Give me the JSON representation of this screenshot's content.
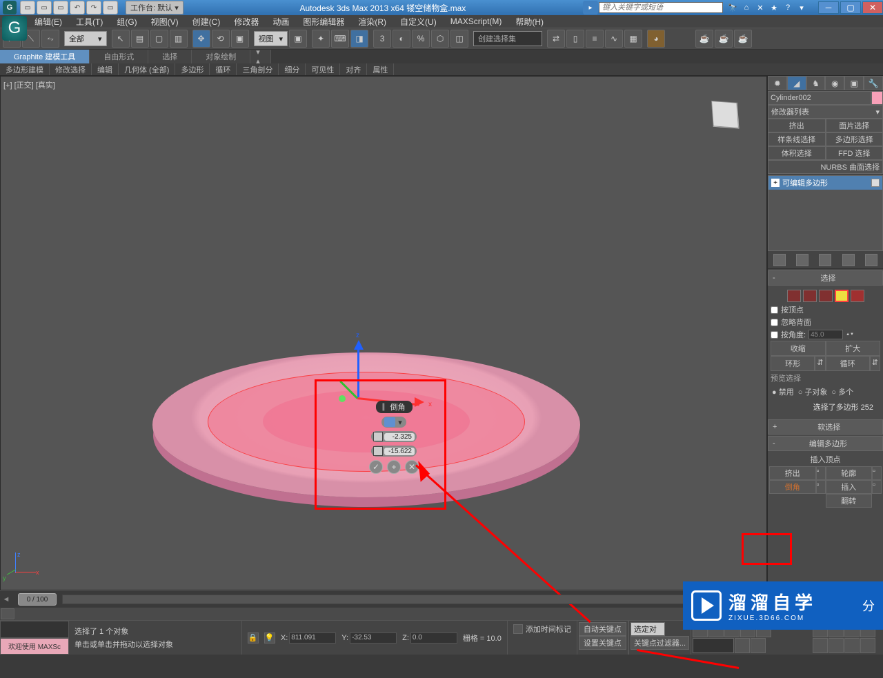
{
  "title": "Autodesk 3ds Max  2013 x64    镂空储物盒.max",
  "searchPlaceholder": "键入关键字或短语",
  "workspace": "工作台: 默认",
  "menus": [
    "编辑(E)",
    "工具(T)",
    "组(G)",
    "视图(V)",
    "创建(C)",
    "修改器",
    "动画",
    "图形编辑器",
    "渲染(R)",
    "自定义(U)",
    "MAXScript(M)",
    "帮助(H)"
  ],
  "ribbonTabs": [
    "Graphite 建模工具",
    "自由形式",
    "选择",
    "对象绘制"
  ],
  "subRibbon": [
    "多边形建模",
    "修改选择",
    "编辑",
    "几何体 (全部)",
    "多边形",
    "循环",
    "三角剖分",
    "细分",
    "可见性",
    "对齐",
    "属性"
  ],
  "filterAll": "全部",
  "viewDrop": "视图",
  "selSetPlaceholder": "创建选择集",
  "viewportLabel": "[+] [正交] [真实]",
  "caddy": {
    "title": "倒角",
    "val1": "-2.325",
    "val2": "-15.622"
  },
  "right": {
    "objName": "Cylinder002",
    "modListLabel": "修改器列表",
    "cats": [
      "挤出",
      "面片选择",
      "样条线选择",
      "多边形选择",
      "体积选择",
      "FFD 选择"
    ],
    "nurbs": "NURBS 曲面选择",
    "stack": "可编辑多边形",
    "selection": {
      "hdr": "选择",
      "byVertex": "按顶点",
      "ignoreBack": "忽略背面",
      "byAngle": "按角度:",
      "angleVal": "45.0",
      "shrink": "收缩",
      "grow": "扩大",
      "ring": "环形",
      "loop": "循环",
      "preview": "预览选择",
      "disable": "禁用",
      "subObj": "子对象",
      "multi": "多个",
      "selCount": "选择了多边形 252"
    },
    "softSel": "软选择",
    "editPoly": {
      "hdr": "编辑多边形",
      "insertVtx": "插入顶点",
      "extrude": "挤出",
      "outline": "轮廓",
      "bevel": "倒角",
      "inset": "插入",
      "flip": "翻转"
    }
  },
  "timeline": {
    "slider": "0 / 100"
  },
  "status": {
    "selText": "选择了 1 个对象",
    "hint": "单击或单击并拖动以选择对象",
    "x": "811.091",
    "y": "-32.53",
    "z": "0.0",
    "grid": "栅格 = 10.0",
    "addTimeTag": "添加时间标记",
    "autoKey": "自动关键点",
    "setKey": "设置关键点",
    "keyFilter": "关键点过滤器...",
    "selKey": "选定对",
    "welcome": "欢迎使用  MAXSc"
  },
  "watermark": {
    "big": "溜溜自学",
    "small": "ZIXUE.3D66.COM",
    "tail": "分"
  }
}
